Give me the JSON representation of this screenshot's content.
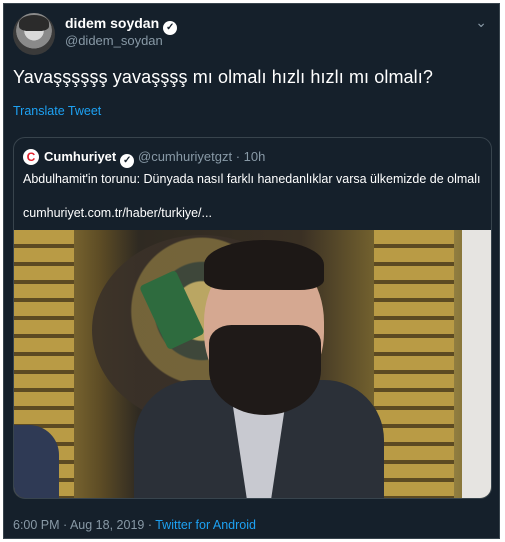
{
  "author": {
    "display_name": "didem soydan",
    "handle": "@didem_soydan"
  },
  "tweet": {
    "text": "Yavaşşşşşş yavaşşşş mı olmalı hızlı hızlı mı olmalı?",
    "translate_label": "Translate Tweet"
  },
  "quoted": {
    "logo_letter": "C",
    "name": "Cumhuriyet",
    "meta": "@cumhuriyetgzt · 10h",
    "text": "Abdulhamit'in torunu: Dünyada nasıl farklı hanedanlıklar varsa ülkemizde de olmalı",
    "link": "cumhuriyet.com.tr/haber/turkiye/..."
  },
  "footer": {
    "timestamp": "6:00 PM · Aug 18, 2019 · ",
    "source": "Twitter for Android"
  },
  "icons": {
    "verified": "verified-badge-icon",
    "more": "chevron-down-icon"
  },
  "colors": {
    "background": "#15202b",
    "link": "#1da1f2",
    "secondary_text": "#8899a6"
  }
}
